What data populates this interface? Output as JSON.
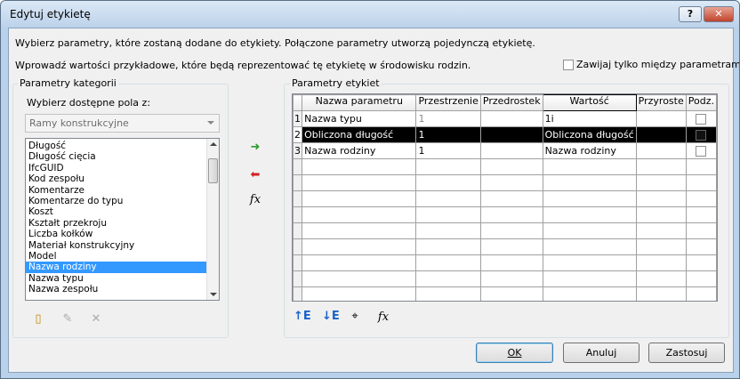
{
  "window": {
    "title": "Edytuj etykietę",
    "help_label": "?",
    "close_label": "✕"
  },
  "intro": {
    "line1": "Wybierz parametry, które zostaną dodane do etykiety. Połączone parametry utworzą pojedynczą etykietę.",
    "line2": "Wprowadź wartości przykładowe, które będą reprezentować tę etykietę w środowisku rodzin.",
    "wrap_label": "Zawijaj tylko między parametrami",
    "wrap_checked": false
  },
  "category": {
    "group_label": "Parametry kategorii",
    "select_label": "Wybierz dostępne pola z:",
    "combo_value": "Ramy konstrukcyjne",
    "items": [
      "Długość",
      "Długość cięcia",
      "IfcGUID",
      "Kod zespołu",
      "Komentarze",
      "Komentarze do typu",
      "Koszt",
      "Kształt przekroju",
      "Liczba kołków",
      "Materiał konstrukcyjny",
      "Model",
      "Nazwa rodziny",
      "Nazwa typu",
      "Nazwa zespołu"
    ],
    "selected_item": "Nazwa rodziny"
  },
  "label_params": {
    "group_label": "Parametry etykiet",
    "columns": [
      "Nazwa parametru",
      "Przestrzenie",
      "Przedrostek",
      "Wartość",
      "Przyroste",
      "Podz."
    ],
    "rows": [
      {
        "num": "1",
        "name": "Nazwa typu",
        "spaces": "1",
        "prefix": "",
        "value": "1i",
        "suffix": "",
        "break": false
      },
      {
        "num": "2",
        "name": "Obliczona długość",
        "spaces": "1",
        "prefix": "",
        "value": "Obliczona długość",
        "suffix": "",
        "break": false
      },
      {
        "num": "3",
        "name": "Nazwa rodziny",
        "spaces": "1",
        "prefix": "",
        "value": "Nazwa rodziny",
        "suffix": "",
        "break": false
      }
    ],
    "selected_row": "2"
  },
  "buttons": {
    "ok": "OK",
    "cancel": "Anuluj",
    "apply": "Zastosuj"
  },
  "icons": {
    "add": "add-parameter-icon",
    "remove": "remove-parameter-icon",
    "formula": "fx-icon",
    "new_param": "new-parameter-icon",
    "edit_param": "edit-parameter-icon",
    "delete_param": "delete-parameter-icon",
    "move_up": "move-up-icon",
    "move_down": "move-down-icon",
    "format": "format-icon",
    "formula_edit": "edit-formula-icon"
  },
  "colors": {
    "selection": "#3399ff",
    "row_selected": "#000000",
    "green_arrow": "#2e9a2e",
    "red_arrow": "#d42020",
    "blue_icon": "#1a64c8"
  }
}
